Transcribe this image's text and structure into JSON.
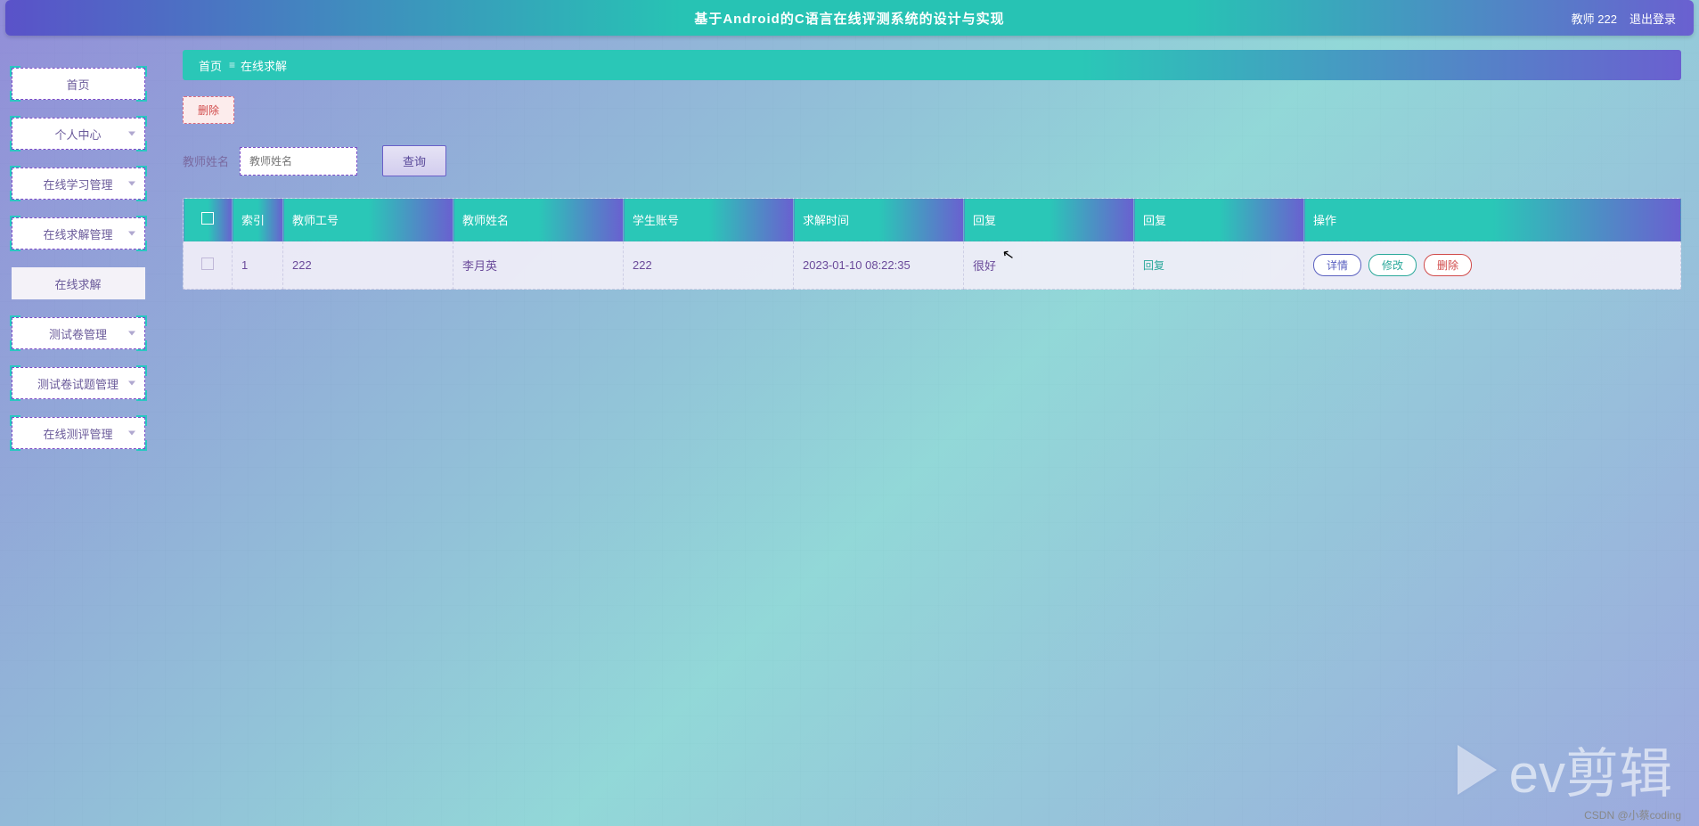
{
  "header": {
    "title": "基于Android的C语言在线评测系统的设计与实现",
    "user": "教师 222",
    "logout": "退出登录"
  },
  "sidebar": {
    "items": [
      {
        "label": "首页",
        "expandable": false,
        "active": false
      },
      {
        "label": "个人中心",
        "expandable": true,
        "active": false
      },
      {
        "label": "在线学习管理",
        "expandable": true,
        "active": false
      },
      {
        "label": "在线求解管理",
        "expandable": true,
        "active": false
      },
      {
        "label": "在线求解",
        "expandable": false,
        "active": true
      },
      {
        "label": "测试卷管理",
        "expandable": true,
        "active": false
      },
      {
        "label": "测试卷试题管理",
        "expandable": true,
        "active": false
      },
      {
        "label": "在线测评管理",
        "expandable": true,
        "active": false
      }
    ]
  },
  "breadcrumb": {
    "home": "首页",
    "current": "在线求解"
  },
  "toolbar": {
    "delete_label": "删除"
  },
  "search": {
    "label": "教师姓名",
    "placeholder": "教师姓名",
    "query_label": "查询"
  },
  "table": {
    "headers": {
      "index": "索引",
      "teacher_no": "教师工号",
      "teacher_name": "教师姓名",
      "student_acct": "学生账号",
      "solve_time": "求解时间",
      "reply1": "回复",
      "reply2": "回复",
      "ops": "操作"
    },
    "rows": [
      {
        "index": "1",
        "teacher_no": "222",
        "teacher_name": "李月英",
        "student_acct": "222",
        "solve_time": "2023-01-10 08:22:35",
        "reply1": "很好",
        "reply2_link": "回复"
      }
    ],
    "op_labels": {
      "detail": "详情",
      "edit": "修改",
      "delete": "删除"
    }
  },
  "watermark": {
    "text": "ev剪辑",
    "csdn": "CSDN @小蔡coding"
  }
}
